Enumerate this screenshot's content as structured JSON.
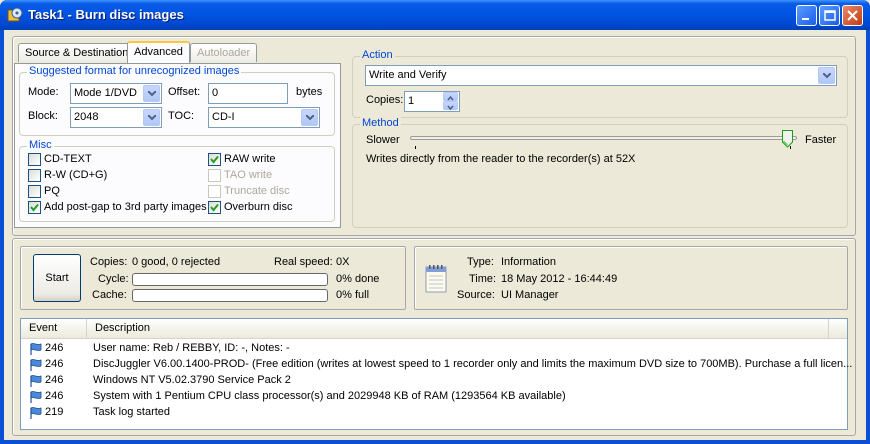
{
  "window": {
    "title": "Task1 - Burn disc images"
  },
  "tabs": [
    {
      "label": "Source & Destination",
      "state": "normal"
    },
    {
      "label": "Advanced",
      "state": "active"
    },
    {
      "label": "Autoloader",
      "state": "disabled"
    }
  ],
  "format_group": {
    "title": "Suggested format for unrecognized images",
    "mode_label": "Mode:",
    "mode_value": "Mode 1/DVD",
    "offset_label": "Offset:",
    "offset_value": "0",
    "offset_unit": "bytes",
    "block_label": "Block:",
    "block_value": "2048",
    "toc_label": "TOC:",
    "toc_value": "CD-I"
  },
  "misc_group": {
    "title": "Misc",
    "options": [
      {
        "label": "CD-TEXT",
        "checked": false,
        "enabled": true
      },
      {
        "label": "RAW write",
        "checked": true,
        "enabled": true
      },
      {
        "label": "R-W (CD+G)",
        "checked": false,
        "enabled": true
      },
      {
        "label": "TAO write",
        "checked": false,
        "enabled": false
      },
      {
        "label": "PQ",
        "checked": false,
        "enabled": true
      },
      {
        "label": "Truncate disc",
        "checked": false,
        "enabled": false
      },
      {
        "label": "Add post-gap to 3rd party images",
        "checked": true,
        "enabled": true
      },
      {
        "label": "Overburn disc",
        "checked": true,
        "enabled": true
      }
    ]
  },
  "action_group": {
    "title": "Action",
    "action_value": "Write and Verify",
    "copies_label": "Copies:",
    "copies_value": "1"
  },
  "method_group": {
    "title": "Method",
    "slower_label": "Slower",
    "faster_label": "Faster",
    "speed_level": 1.0,
    "description": "Writes directly from the reader to the recorder(s) at 52X"
  },
  "status": {
    "start_label": "Start",
    "copies_label": "Copies:",
    "copies_value": "0 good, 0 rejected",
    "real_speed_label": "Real speed:",
    "real_speed_value": "0X",
    "cycle_label": "Cycle:",
    "cycle_value": "0% done",
    "cycle_progress": 0,
    "cache_label": "Cache:",
    "cache_value": "0% full",
    "cache_progress": 0
  },
  "info": {
    "type_label": "Type:",
    "type_value": "Information",
    "time_label": "Time:",
    "time_value": "18 May 2012 - 16:44:49",
    "source_label": "Source:",
    "source_value": "UI Manager"
  },
  "log": {
    "columns": [
      "Event",
      "Description"
    ],
    "rows": [
      {
        "event": "246",
        "description": "User name: Reb / REBBY, ID: -, Notes: -"
      },
      {
        "event": "246",
        "description": "DiscJuggler V6.00.1400-PROD- (Free edition (writes at lowest speed to 1 recorder only and limits the maximum DVD size to 700MB). Purchase a full licen..."
      },
      {
        "event": "246",
        "description": "Windows NT V5.02.3790 Service Pack 2"
      },
      {
        "event": "246",
        "description": "System with 1 Pentium CPU class processor(s) and 2029948 KB of RAM (1293564 KB available)"
      },
      {
        "event": "219",
        "description": "Task log started"
      }
    ]
  }
}
